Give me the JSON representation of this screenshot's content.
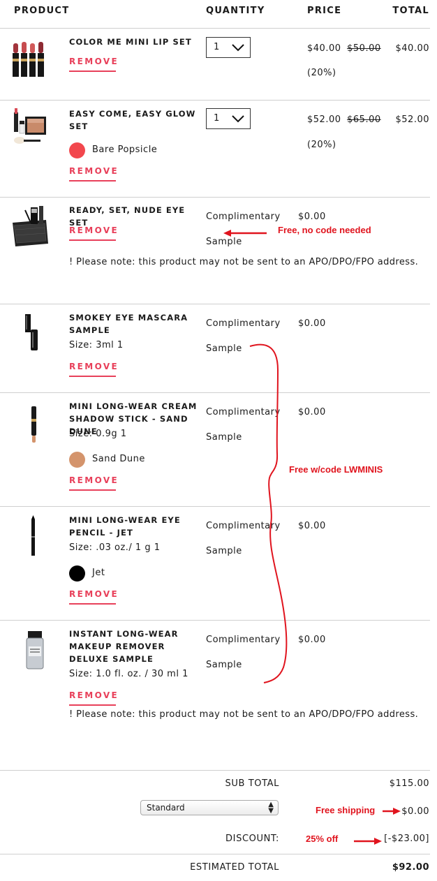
{
  "header": {
    "product": "PRODUCT",
    "quantity": "QUANTITY",
    "price": "PRICE",
    "total": "TOTAL"
  },
  "remove_label": "REMOVE",
  "items": [
    {
      "name": "COLOR ME MINI LIP SET",
      "quantity": "1",
      "price": "$40.00",
      "original_price": "$50.00",
      "discount": "(20%)",
      "total": "$40.00"
    },
    {
      "name": "EASY COME, EASY GLOW SET",
      "quantity": "1",
      "swatch": {
        "label": "Bare Popsicle",
        "color": "#f2474d"
      },
      "price": "$52.00",
      "original_price": "$65.00",
      "discount": "(20%)",
      "total": "$52.00"
    },
    {
      "name": "READY, SET, NUDE EYE SET",
      "complimentary": "Complimentary",
      "sample": "Sample",
      "price": "$0.00",
      "note": "! Please note: this product may not be sent to an APO/DPO/FPO address."
    },
    {
      "name": "SMOKEY EYE MASCARA SAMPLE",
      "size": "Size: 3ml 1",
      "complimentary": "Complimentary",
      "sample": "Sample",
      "price": "$0.00"
    },
    {
      "name": "MINI LONG-WEAR CREAM SHADOW STICK - SAND DUNE",
      "size": "Size: 0.9g 1",
      "swatch": {
        "label": "Sand Dune",
        "color": "#d4946c"
      },
      "complimentary": "Complimentary",
      "sample": "Sample",
      "price": "$0.00"
    },
    {
      "name": "MINI LONG-WEAR EYE PENCIL - JET",
      "size": "Size: .03 oz./ 1 g 1",
      "swatch": {
        "label": "Jet",
        "color": "#000000"
      },
      "complimentary": "Complimentary",
      "sample": "Sample",
      "price": "$0.00"
    },
    {
      "name": "INSTANT LONG-WEAR MAKEUP REMOVER DELUXE SAMPLE",
      "size": "Size: 1.0 fl. oz. / 30 ml 1",
      "complimentary": "Complimentary",
      "sample": "Sample",
      "price": "$0.00",
      "note": "! Please note: this product may not be sent to an APO/DPO/FPO address."
    }
  ],
  "annotations": {
    "free_no_code": "Free, no code needed",
    "free_with_code": "Free w/code LWMINIS",
    "free_shipping": "Free shipping",
    "discount_off": "25% off",
    "color": "#e0141e"
  },
  "summary": {
    "subtotal_label": "SUB TOTAL",
    "subtotal": "$115.00",
    "shipping_option": "Standard",
    "shipping": "$0.00",
    "discount_label": "DISCOUNT:",
    "discount": "[-$23.00]",
    "estimated_label": "ESTIMATED TOTAL",
    "estimated_total": "$92.00"
  }
}
